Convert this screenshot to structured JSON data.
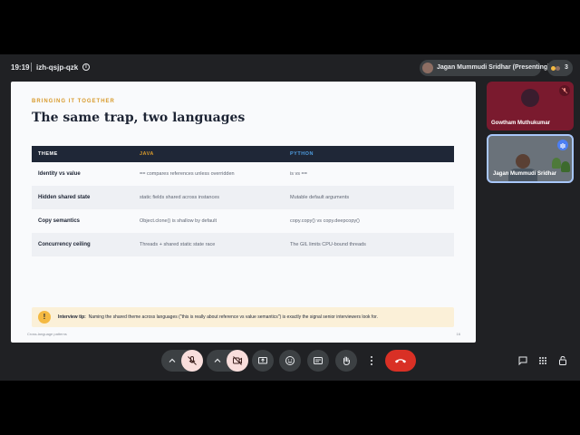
{
  "meeting": {
    "time": "19:19",
    "code": "izh-qsjp-qzk",
    "presenter_label": "Jagan Mummudi Sridhar (Presenting)",
    "participant_count": "3"
  },
  "participants": [
    {
      "name": "Gowtham Muthukumar",
      "muted": true
    },
    {
      "name": "Jagan Mummudi Sridhar",
      "speaking": true
    }
  ],
  "slide": {
    "eyebrow": "BRINGING IT TOGETHER",
    "title": "The same trap, two languages",
    "headers": [
      "THEME",
      "JAVA",
      "PYTHON"
    ],
    "header_colors": [
      "#ffffff",
      "#d89a2b",
      "#4f9de0"
    ],
    "rows": [
      [
        "Identity vs value",
        "== compares references unless overridden",
        "is vs =="
      ],
      [
        "Hidden shared state",
        "static fields shared across instances",
        "Mutable default arguments"
      ],
      [
        "Copy semantics",
        "Object.clone() is shallow by default",
        "copy.copy() vs copy.deepcopy()"
      ],
      [
        "Concurrency ceiling",
        "Threads + shared static state race",
        "The GIL limits CPU-bound threads"
      ]
    ],
    "tip_icon": "!",
    "tip_label": "Interview tip:",
    "tip_text": "Naming the shared theme across languages (\"this is really about reference vs value semantics\") is exactly the signal senior interviewers look for.",
    "footer_left": "Cross-language patterns",
    "page_number": "16"
  },
  "controls": {
    "items": [
      "chevron-up-icon",
      "mic-off-icon",
      "chevron-up-icon",
      "camera-off-icon",
      "present-icon",
      "emoji-icon",
      "captions-icon",
      "raise-hand-icon",
      "more-icon",
      "end-call-icon"
    ],
    "side_items": [
      "chat-icon",
      "apps-icon",
      "host-controls-icon"
    ]
  }
}
